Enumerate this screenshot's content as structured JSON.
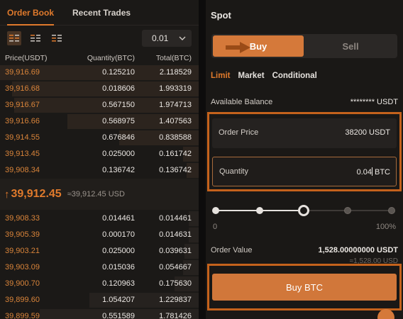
{
  "order_book": {
    "tabs": [
      {
        "label": "Order Book",
        "active": true
      },
      {
        "label": "Recent Trades",
        "active": false
      }
    ],
    "view_icons": [
      "order-book-both-icon",
      "order-book-bids-icon",
      "order-book-asks-icon"
    ],
    "precision": "0.01",
    "headers": {
      "price": "Price(USDT)",
      "quantity": "Quantity(BTC)",
      "total": "Total(BTC)"
    },
    "asks": [
      {
        "price": "39,916.69",
        "qty": "0.125210",
        "total": "2.118529",
        "depth": 1.0
      },
      {
        "price": "39,916.68",
        "qty": "0.018606",
        "total": "1.993319",
        "depth": 0.94
      },
      {
        "price": "39,916.67",
        "qty": "0.567150",
        "total": "1.974713",
        "depth": 0.93
      },
      {
        "price": "39,916.66",
        "qty": "0.568975",
        "total": "1.407563",
        "depth": 0.66
      },
      {
        "price": "39,914.55",
        "qty": "0.676846",
        "total": "0.838588",
        "depth": 0.4
      },
      {
        "price": "39,913.45",
        "qty": "0.025000",
        "total": "0.161742",
        "depth": 0.08
      },
      {
        "price": "39,908.34",
        "qty": "0.136742",
        "total": "0.136742",
        "depth": 0.06
      }
    ],
    "last_price": "39,912.45",
    "last_price_usd": "≈39,912.45 USD",
    "bids": [
      {
        "price": "39,908.33",
        "qty": "0.014461",
        "total": "0.014461",
        "depth": 0.05
      },
      {
        "price": "39,905.39",
        "qty": "0.000170",
        "total": "0.014631",
        "depth": 0.05
      },
      {
        "price": "39,903.21",
        "qty": "0.025000",
        "total": "0.039631",
        "depth": 0.07
      },
      {
        "price": "39,903.09",
        "qty": "0.015036",
        "total": "0.054667",
        "depth": 0.08
      },
      {
        "price": "39,900.70",
        "qty": "0.120963",
        "total": "0.175630",
        "depth": 0.12
      },
      {
        "price": "39,899.60",
        "qty": "1.054207",
        "total": "1.229837",
        "depth": 0.55
      },
      {
        "price": "39,899.59",
        "qty": "0.551589",
        "total": "1.781426",
        "depth": 0.8
      }
    ]
  },
  "trade": {
    "title": "Spot",
    "buy_label": "Buy",
    "sell_label": "Sell",
    "order_types": [
      {
        "label": "Limit",
        "active": true
      },
      {
        "label": "Market",
        "active": false
      },
      {
        "label": "Conditional",
        "active": false
      }
    ],
    "available_balance_label": "Available Balance",
    "available_balance_value": "******** USDT",
    "order_price_label": "Order Price",
    "order_price_value": "38200",
    "order_price_unit": "USDT",
    "quantity_label": "Quantity",
    "quantity_value": "0.04",
    "quantity_unit": "BTC",
    "slider_percent": 50,
    "slider_min_label": "0",
    "slider_max_label": "100%",
    "order_value_label": "Order Value",
    "order_value_value": "1,528.00000000 USDT",
    "order_value_approx": "≈1,528.00 USD",
    "submit_label": "Buy BTC"
  },
  "colors": {
    "accent": "#e07a2c",
    "buy": "#d5793a",
    "highlight_border": "#c4621c"
  }
}
